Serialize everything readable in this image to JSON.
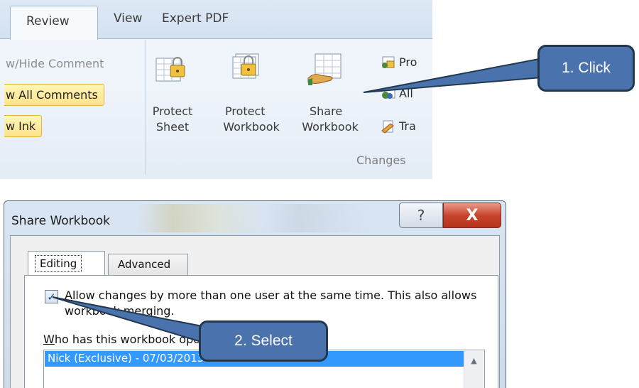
{
  "ribbon": {
    "tabs": [
      {
        "label": "Review",
        "active": true
      },
      {
        "label": "View"
      },
      {
        "label": "Expert PDF"
      }
    ],
    "comments": {
      "show_hide": "w/Hide Comment",
      "show_all": "w All Comments",
      "show_ink": "w Ink"
    },
    "changes": {
      "protect_sheet": [
        "Protect",
        "Sheet"
      ],
      "protect_workbook": [
        "Protect",
        "Workbook"
      ],
      "share_workbook": [
        "Share",
        "Workbook"
      ],
      "side_items": [
        "Pro",
        "All",
        "Tra"
      ],
      "group_label": "Changes"
    }
  },
  "callouts": {
    "step1": "1. Click",
    "step2": "2. Select"
  },
  "dialog": {
    "title": "Share Workbook",
    "help_glyph": "?",
    "close_glyph": "X",
    "tabs": [
      "Editing",
      "Advanced"
    ],
    "allow_checkbox": {
      "checked": true,
      "accesskey": "A",
      "label_rest": "llow changes by more than one user at the same time.  This also allows workbook merging."
    },
    "who_label_accesskey": "W",
    "who_label_rest": "ho has this workbook open now:",
    "users": [
      "Nick (Exclusive) - 07/03/2013 04:32"
    ]
  },
  "colors": {
    "callout_fill": "#4a73ad",
    "callout_border": "#22384f",
    "selection": "#3399ff",
    "close_button": "#c9442d"
  }
}
